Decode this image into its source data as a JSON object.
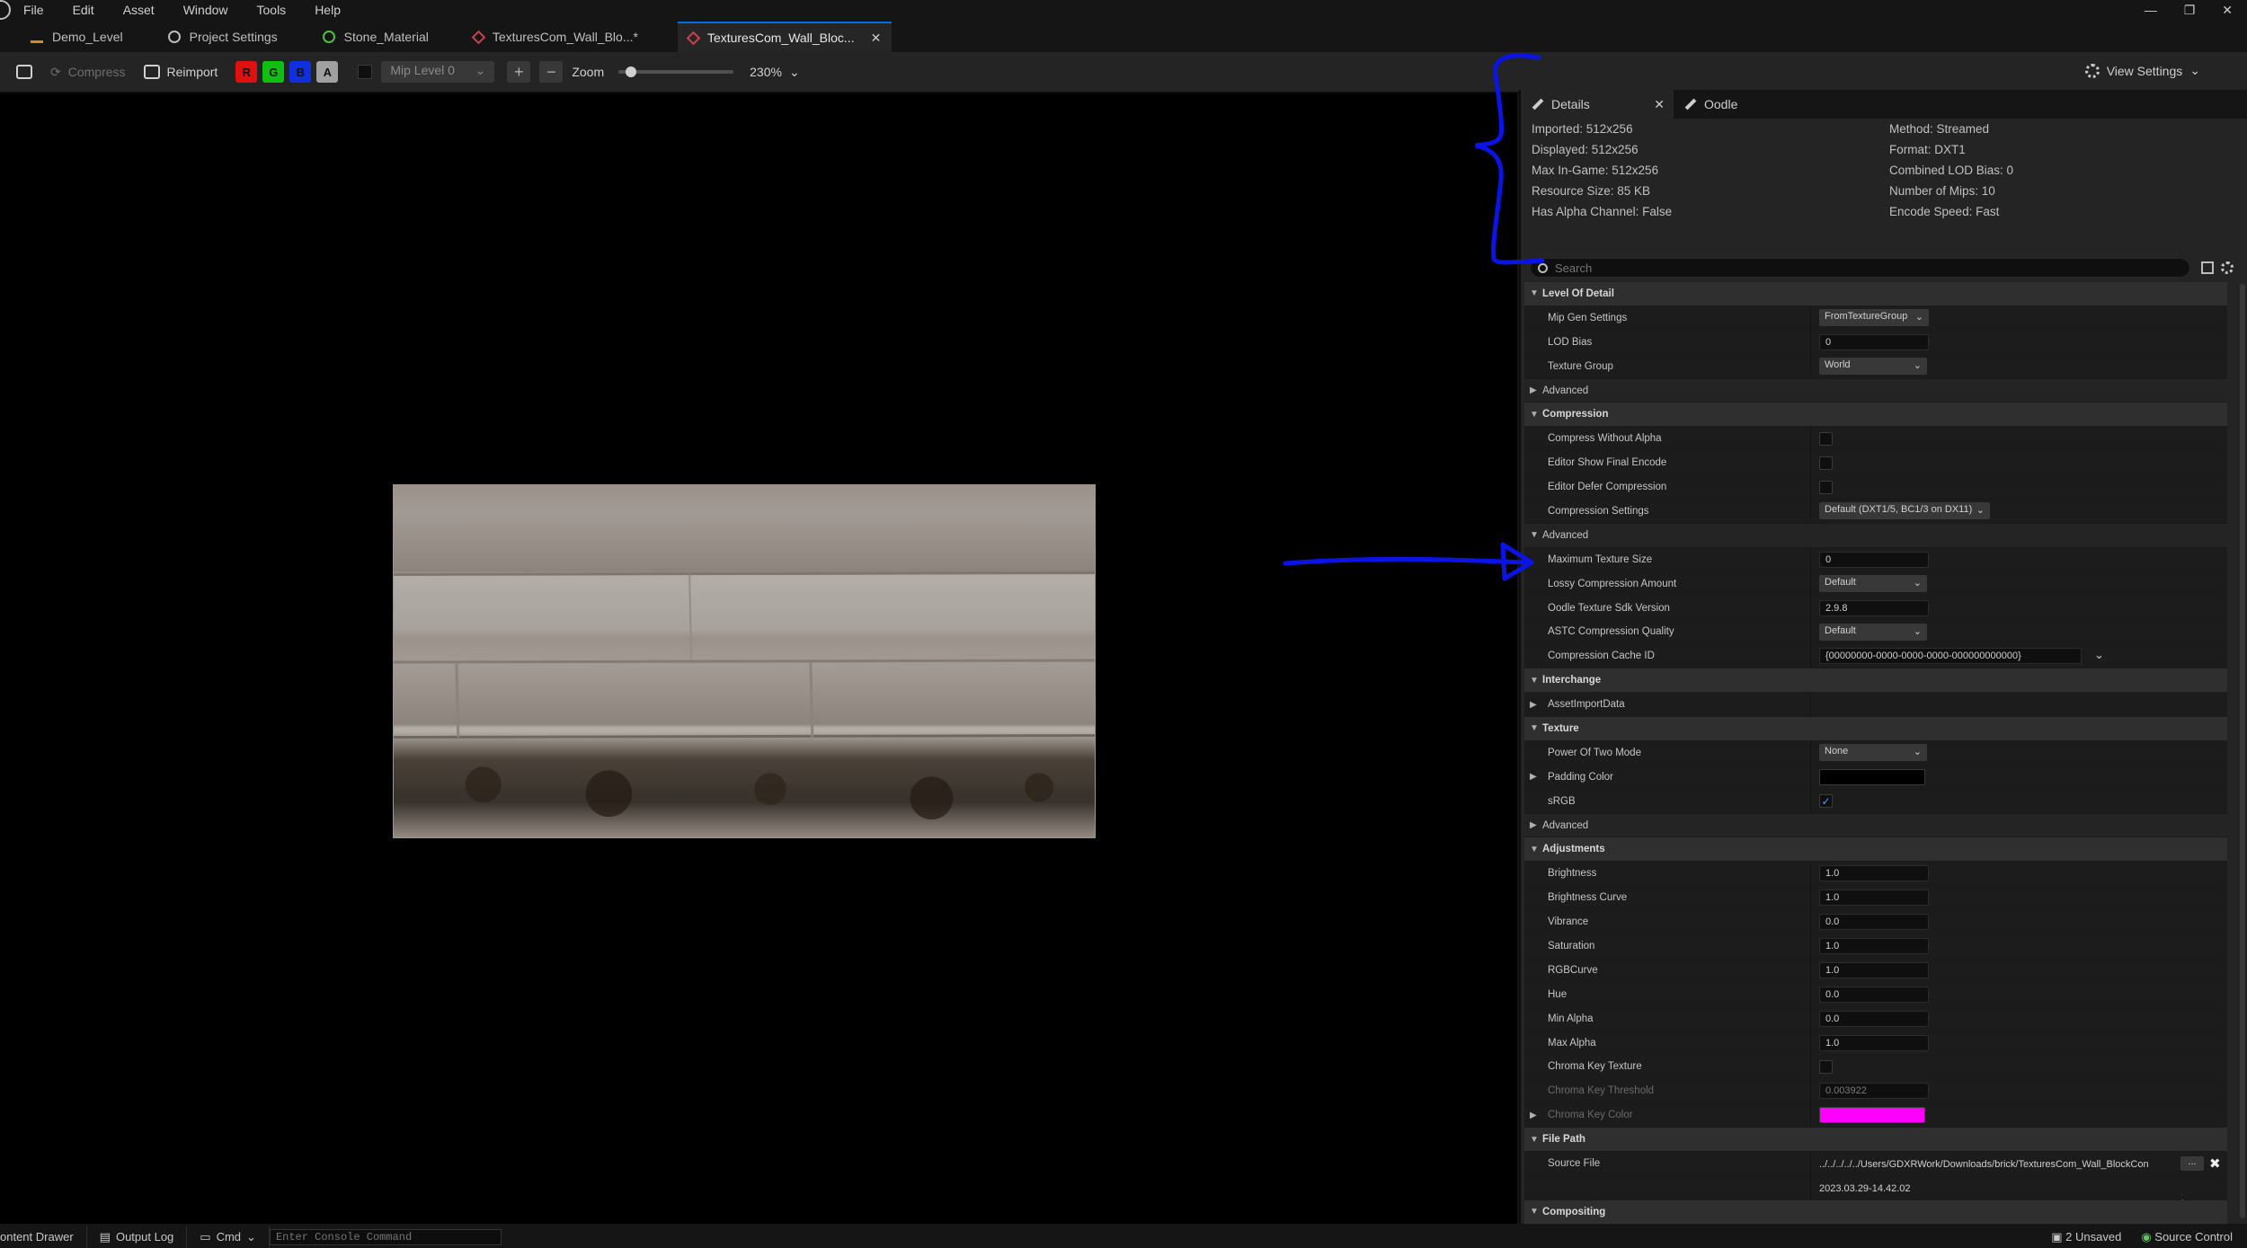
{
  "menu": [
    "File",
    "Edit",
    "Asset",
    "Window",
    "Tools",
    "Help"
  ],
  "window_controls": [
    "—",
    "❐",
    "✕"
  ],
  "tabs": [
    {
      "label": "Demo_Level",
      "icon": "level-icon"
    },
    {
      "label": "Project Settings",
      "icon": "settings-icon"
    },
    {
      "label": "Stone_Material",
      "icon": "material-icon"
    },
    {
      "label": "TexturesCom_Wall_Blo...*",
      "icon": "texture-icon"
    },
    {
      "label": "TexturesCom_Wall_Bloc...",
      "icon": "texture-icon",
      "active": true
    }
  ],
  "toolbar": {
    "compress": "Compress",
    "reimport": "Reimport",
    "channels": [
      "R",
      "G",
      "B",
      "A"
    ],
    "mip_level": "Mip Level 0",
    "zoom_label": "Zoom",
    "zoom_value": "230%",
    "zoom_slider_fraction": 0.07,
    "view_settings": "View Settings"
  },
  "details": {
    "tab_details": "Details",
    "tab_oodle": "Oodle",
    "info_left": [
      "Imported: 512x256",
      "Displayed: 512x256",
      "Max In-Game: 512x256",
      "Resource Size: 85 KB",
      "Has Alpha Channel: False"
    ],
    "info_right": [
      "Method: Streamed",
      "Format: DXT1",
      "Combined LOD Bias: 0",
      "Number of Mips: 10",
      "Encode Speed: Fast"
    ],
    "search_placeholder": "Search",
    "rows": [
      {
        "type": "cat",
        "name": "Level Of Detail"
      },
      {
        "type": "prop",
        "name": "Mip Gen Settings",
        "kind": "combo",
        "value": "FromTextureGroup",
        "w": "w115"
      },
      {
        "type": "prop",
        "name": "LOD Bias",
        "kind": "box",
        "value": "0"
      },
      {
        "type": "prop",
        "name": "Texture Group",
        "kind": "combo",
        "value": "World"
      },
      {
        "type": "sub",
        "name": "Advanced",
        "arrow": "▶"
      },
      {
        "type": "cat",
        "name": "Compression"
      },
      {
        "type": "prop",
        "name": "Compress Without Alpha",
        "kind": "check"
      },
      {
        "type": "prop",
        "name": "Editor Show Final Encode",
        "kind": "check"
      },
      {
        "type": "prop",
        "name": "Editor Defer Compression",
        "kind": "check"
      },
      {
        "type": "prop",
        "name": "Compression Settings",
        "kind": "combo",
        "value": "Default (DXT1/5, BC1/3 on DX11)",
        "w": "w190"
      },
      {
        "type": "sub",
        "name": "Advanced",
        "arrow": "▼"
      },
      {
        "type": "prop",
        "name": "Maximum Texture Size",
        "kind": "box",
        "value": "0"
      },
      {
        "type": "prop",
        "name": "Lossy Compression Amount",
        "kind": "combo",
        "value": "Default"
      },
      {
        "type": "prop",
        "name": "Oodle Texture Sdk Version",
        "kind": "box",
        "value": "2.9.8"
      },
      {
        "type": "prop",
        "name": "ASTC Compression Quality",
        "kind": "combo",
        "value": "Default"
      },
      {
        "type": "prop",
        "name": "Compression Cache ID",
        "kind": "wide",
        "value": "{00000000-0000-0000-0000-000000000000}"
      },
      {
        "type": "cat",
        "name": "Interchange"
      },
      {
        "type": "prop",
        "name": "AssetImportData",
        "kind": "none",
        "arrow": "▶"
      },
      {
        "type": "cat",
        "name": "Texture"
      },
      {
        "type": "prop",
        "name": "Power Of Two Mode",
        "kind": "combo",
        "value": "None"
      },
      {
        "type": "prop",
        "name": "Padding Color",
        "kind": "swatch",
        "color": "#000000",
        "arrow": "▶"
      },
      {
        "type": "prop",
        "name": "sRGB",
        "kind": "check",
        "checked": true
      },
      {
        "type": "sub",
        "name": "Advanced",
        "arrow": "▶"
      },
      {
        "type": "cat",
        "name": "Adjustments"
      },
      {
        "type": "prop",
        "name": "Brightness",
        "kind": "box",
        "value": "1.0"
      },
      {
        "type": "prop",
        "name": "Brightness Curve",
        "kind": "box",
        "value": "1.0"
      },
      {
        "type": "prop",
        "name": "Vibrance",
        "kind": "box",
        "value": "0.0"
      },
      {
        "type": "prop",
        "name": "Saturation",
        "kind": "box",
        "value": "1.0"
      },
      {
        "type": "prop",
        "name": "RGBCurve",
        "kind": "box",
        "value": "1.0"
      },
      {
        "type": "prop",
        "name": "Hue",
        "kind": "box",
        "value": "0.0"
      },
      {
        "type": "prop",
        "name": "Min Alpha",
        "kind": "box",
        "value": "0.0"
      },
      {
        "type": "prop",
        "name": "Max Alpha",
        "kind": "box",
        "value": "1.0"
      },
      {
        "type": "prop",
        "name": "Chroma Key Texture",
        "kind": "check"
      },
      {
        "type": "prop",
        "name": "Chroma Key Threshold",
        "kind": "box",
        "value": "0.003922",
        "disabled": true
      },
      {
        "type": "prop",
        "name": "Chroma Key Color",
        "kind": "swatch",
        "color": "#ff00ff",
        "disabled": true,
        "arrow": "▶"
      },
      {
        "type": "cat",
        "name": "File Path"
      },
      {
        "type": "prop",
        "name": "Source File",
        "kind": "path",
        "value": "../../../../../Users/GDXRWork/Downloads/brick/TexturesCom_Wall_BlockCon"
      },
      {
        "type": "prop",
        "name": "",
        "kind": "text",
        "value": "2023.03.29-14.42.02"
      },
      {
        "type": "cat",
        "name": "Compositing"
      }
    ]
  },
  "statusbar": {
    "content_drawer": "ontent Drawer",
    "output_log": "Output Log",
    "cmd": "Cmd",
    "console_placeholder": "Enter Console Command",
    "unsaved": "2 Unsaved",
    "source_control": "Source Control"
  },
  "colors": {
    "accent": "#0070e0",
    "annotation": "#0a14e6"
  }
}
